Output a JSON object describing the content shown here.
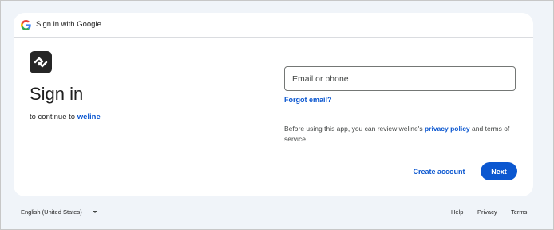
{
  "header": {
    "title": "Sign in with Google"
  },
  "app": {
    "name": "weline"
  },
  "main": {
    "title": "Sign in",
    "continue_prefix": "to continue to ",
    "app_link": "weline"
  },
  "form": {
    "email": {
      "placeholder": "Email or phone",
      "value": ""
    },
    "forgot_email": "Forgot email?",
    "privacy_text_before": "Before using this app, you can review weline's ",
    "privacy_link": "privacy policy",
    "privacy_text_after": " and terms of service."
  },
  "actions": {
    "create_account": "Create account",
    "next": "Next"
  },
  "footer": {
    "language": "English (United States)",
    "help": "Help",
    "privacy": "Privacy",
    "terms": "Terms"
  },
  "colors": {
    "accent": "#0b57d0",
    "background": "#f0f4f9",
    "card": "#ffffff",
    "logo_tile": "#262626"
  },
  "icons": {
    "header_logo": "google-g-icon",
    "app_logo": "weline-logo-icon",
    "language_caret": "caret-down-icon"
  }
}
